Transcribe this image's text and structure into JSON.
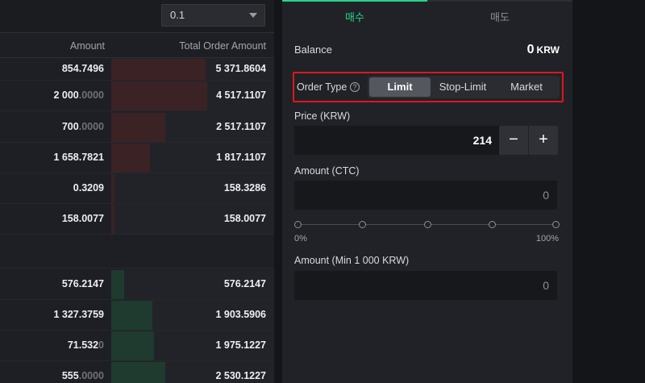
{
  "orderbook": {
    "grouping_select": "0.1",
    "headers": {
      "amount": "Amount",
      "total": "Total Order Amount"
    },
    "asks": [
      {
        "amount_main": "854.7496",
        "amount_dim": "",
        "total": "5 371.8604",
        "depth": 0.58
      },
      {
        "amount_main": "2 000",
        "amount_dim": ".0000",
        "total": "4 517.1107",
        "depth": 0.59
      },
      {
        "amount_main": "700",
        "amount_dim": ".0000",
        "total": "2 517.1107",
        "depth": 0.33
      },
      {
        "amount_main": "1 658.7821",
        "amount_dim": "",
        "total": "1 817.1107",
        "depth": 0.24
      },
      {
        "amount_main": "0.3209",
        "amount_dim": "",
        "total": "158.3286",
        "depth": 0.02
      },
      {
        "amount_main": "158.0077",
        "amount_dim": "",
        "total": "158.0077",
        "depth": 0.02
      }
    ],
    "bids": [
      {
        "amount_main": "576.2147",
        "amount_dim": "",
        "total": "576.2147",
        "depth": 0.08
      },
      {
        "amount_main": "1 327.3759",
        "amount_dim": "",
        "total": "1 903.5906",
        "depth": 0.25
      },
      {
        "amount_main": "71.532",
        "amount_dim": "0",
        "total": "1 975.1227",
        "depth": 0.26
      },
      {
        "amount_main": "555",
        "amount_dim": ".0000",
        "total": "2 530.1227",
        "depth": 0.33
      }
    ]
  },
  "order_panel": {
    "tabs": {
      "buy": "매수",
      "sell": "매도"
    },
    "balance": {
      "label": "Balance",
      "value": "0",
      "unit": "KRW"
    },
    "order_type": {
      "label": "Order Type",
      "help_glyph": "?",
      "options": [
        "Limit",
        "Stop-Limit",
        "Market"
      ],
      "selected": "Limit"
    },
    "price": {
      "label": "Price (KRW)",
      "value": "214",
      "minus": "−",
      "plus": "+"
    },
    "amount": {
      "label": "Amount (CTC)",
      "value": "0"
    },
    "slider": {
      "min_label": "0%",
      "max_label": "100%",
      "value_pct": 0
    },
    "total": {
      "label": "Amount (Min 1 000 KRW)",
      "value": "0"
    }
  },
  "colors": {
    "accent_buy": "#27d58a",
    "ask_bar": "#3a2225",
    "bid_bar": "#1f3a2f",
    "highlight": "#e0161c"
  }
}
